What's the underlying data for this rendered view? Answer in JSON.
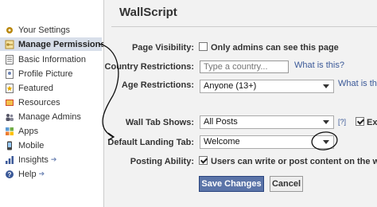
{
  "sidebar": {
    "items": [
      {
        "label": "Your Settings",
        "icon": "settings-icon"
      },
      {
        "label": "Manage Permissions",
        "icon": "key-icon"
      },
      {
        "label": "Basic Information",
        "icon": "info-icon"
      },
      {
        "label": "Profile Picture",
        "icon": "photo-icon"
      },
      {
        "label": "Featured",
        "icon": "star-icon"
      },
      {
        "label": "Resources",
        "icon": "book-icon"
      },
      {
        "label": "Manage Admins",
        "icon": "admins-icon"
      },
      {
        "label": "Apps",
        "icon": "puzzle-icon"
      },
      {
        "label": "Mobile",
        "icon": "phone-icon"
      },
      {
        "label": "Insights",
        "icon": "chart-icon",
        "arrow": "➔"
      },
      {
        "label": "Help",
        "icon": "question-icon",
        "arrow": "➔"
      }
    ],
    "selected": "Manage Permissions"
  },
  "header": {
    "title": "WallScript"
  },
  "form": {
    "page_visibility": {
      "label": "Page Visibility:",
      "checkbox_text": "Only admins can see this page",
      "checked": false
    },
    "country_restrictions": {
      "label": "Country Restrictions:",
      "placeholder": "Type a country...",
      "help_link": "What is this?"
    },
    "age_restrictions": {
      "label": "Age Restrictions:",
      "value": "Anyone (13+)",
      "help_link": "What is th"
    },
    "wall_tab_shows": {
      "label": "Wall Tab Shows:",
      "value": "All Posts",
      "help_mark": "[?]",
      "extra_text": "Exp",
      "extra_checked": true
    },
    "default_landing_tab": {
      "label": "Default Landing Tab:",
      "value": "Welcome"
    },
    "posting_ability": {
      "label": "Posting Ability:",
      "checkbox_text": "Users can write or post content on the wall",
      "checked": true
    }
  },
  "buttons": {
    "save": "Save Changes",
    "cancel": "Cancel"
  },
  "colors": {
    "accent": "#3b5998",
    "selected_bg": "#d8dfea",
    "annotation": "#111111"
  }
}
